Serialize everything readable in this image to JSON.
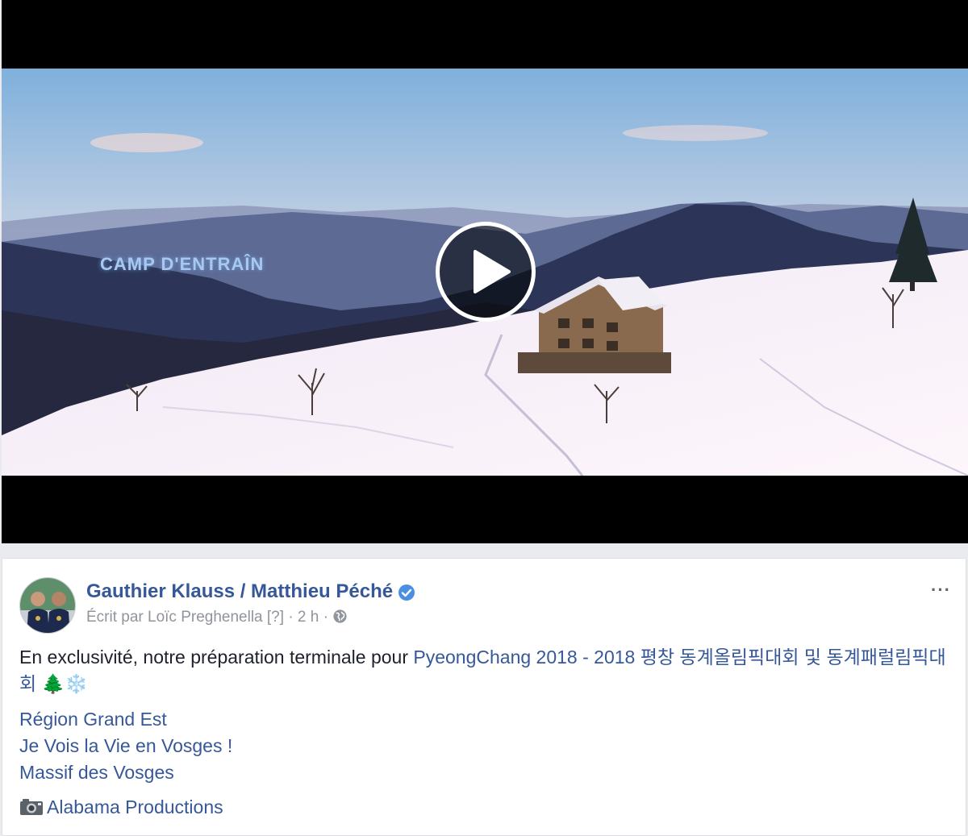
{
  "video": {
    "overlay_text": "CAMP D'ENTRAÎN"
  },
  "post": {
    "author": "Gauthier Klauss / Matthieu Péché",
    "byline": "Écrit par Loïc Preghenella",
    "help": "[?]",
    "time": "2 h",
    "more": "···",
    "text_prefix": "En exclusivité, notre préparation terminale pour ",
    "event_link": "PyeongChang 2018 - 2018 평창 동계올림픽대회 및 동계패럴림픽대회",
    "emoji_tree": "🌲",
    "emoji_snow": "❄️",
    "tag_links": [
      "Région Grand Est",
      "Je Vois la Vie en Vosges !",
      "Massif des Vosges"
    ],
    "credit_link": "Alabama Productions"
  },
  "icons": {
    "play": "play-icon",
    "verified": "verified-badge-icon",
    "globe": "globe-icon",
    "camera": "camera-icon"
  },
  "colors": {
    "link": "#365899",
    "verified": "#4a90e2",
    "meta": "#90949c"
  }
}
